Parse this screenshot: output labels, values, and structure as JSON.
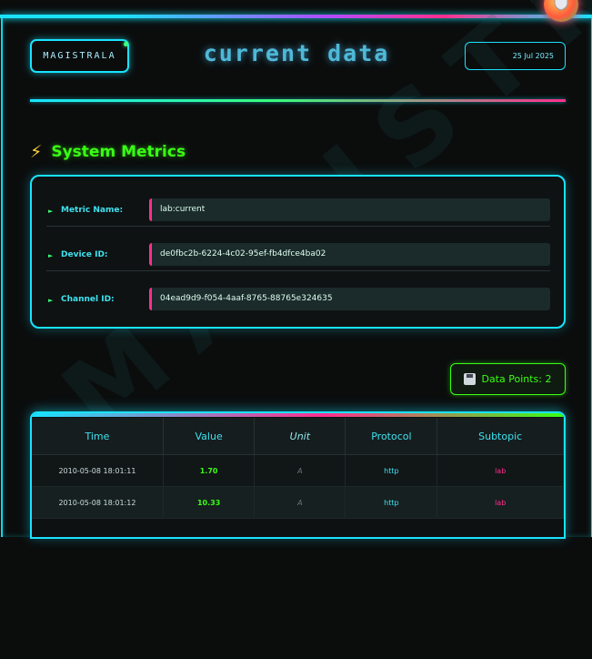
{
  "header": {
    "logo_text": "MAGISTRALA",
    "title": "current data",
    "date": "25 Jul 2025"
  },
  "watermark": "MAGISTRALA",
  "metrics": {
    "title": "System Metrics",
    "icon": "bolt-icon",
    "rows": [
      {
        "label": "Metric Name:",
        "value": "lab:current"
      },
      {
        "label": "Device ID:",
        "value": "de0fbc2b-6224-4c02-95ef-fb4dfce4ba02"
      },
      {
        "label": "Channel ID:",
        "value": "04ead9d9-f054-4aaf-8765-88765e324635"
      }
    ]
  },
  "data_points": {
    "label": "Data Points: 2",
    "icon": "floppy-disk-icon"
  },
  "table": {
    "headers": [
      "Time",
      "Value",
      "Unit",
      "Protocol",
      "Subtopic"
    ],
    "rows": [
      {
        "time": "2010-05-08 18:01:11",
        "value": "1.70",
        "unit": "A",
        "protocol": "http",
        "subtopic": "lab"
      },
      {
        "time": "2010-05-08 18:01:12",
        "value": "10.33",
        "unit": "A",
        "protocol": "http",
        "subtopic": "lab"
      }
    ]
  },
  "colors": {
    "accent_cyan": "#19e3ff",
    "accent_green": "#39ff14",
    "accent_pink": "#ff2e8e"
  }
}
